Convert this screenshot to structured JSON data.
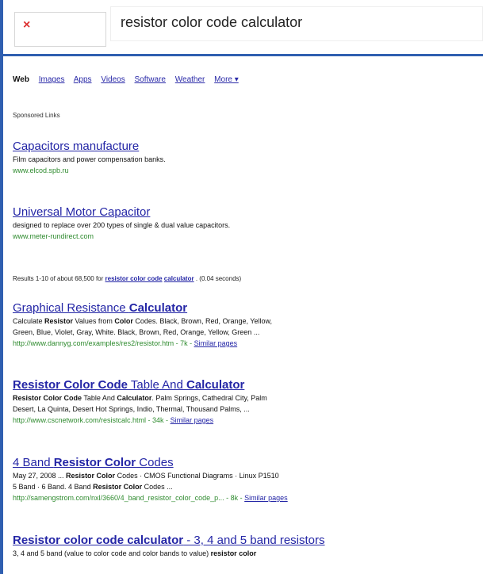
{
  "search": {
    "query": "resistor color code calculator",
    "close_glyph": "×"
  },
  "tabs": [
    {
      "label": "Web",
      "active": true
    },
    {
      "label": "Images"
    },
    {
      "label": "Apps"
    },
    {
      "label": "Videos"
    },
    {
      "label": "Software"
    },
    {
      "label": "Weather"
    },
    {
      "label": "More ▾"
    }
  ],
  "sponsored_label": "Sponsored Links",
  "ads": [
    {
      "title": "Capacitors manufacture",
      "desc": "Film capacitors and power compensation banks.",
      "url": "www.elcod.spb.ru"
    },
    {
      "title": "Universal Motor Capacitor",
      "desc": "designed to replace over 200 types of single & dual value capacitors.",
      "url": "www.meter-rundirect.com"
    }
  ],
  "summary": {
    "prefix": "Results 1-10 of about 68,500 for ",
    "q1": "resistor color code",
    "q2": "calculator",
    "suffix": ". (0.04 seconds)"
  },
  "results": [
    {
      "title_a": "Graphical Resistance ",
      "title_b": "Calculator",
      "desc1_a": "Calculate ",
      "desc1_b": "Resistor",
      "desc1_c": " Values from ",
      "desc1_d": "Color",
      "desc1_e": " Codes. Black, Brown, Red, Orange, Yellow,",
      "desc2": "Green, Blue, Violet, Gray, White. Black, Brown, Red, Orange, Yellow, Green ...",
      "url": "http://www.dannyg.com/examples/res2/resistor.htm - 7k - ",
      "similar": "Similar pages"
    },
    {
      "title_a": "Resistor Color Code",
      "title_b": " Table And ",
      "title_c": "Calculator",
      "desc1_a": "Resistor Color Code",
      "desc1_b": " Table And ",
      "desc1_c": "Calculator",
      "desc1_d": ". Palm Springs, Cathedral City, Palm",
      "desc2": "Desert, La Quinta, Desert Hot Springs, Indio, Thermal, Thousand Palms, ...",
      "url": "http://www.cscnetwork.com/resistcalc.html - 34k - ",
      "similar": "Similar pages"
    },
    {
      "title_a": "4 Band ",
      "title_b": "Resistor Color",
      "title_c": " Codes",
      "desc1_a": "May 27, 2008 ... ",
      "desc1_b": "Resistor Color",
      "desc1_c": " Codes · CMOS Functional Diagrams · Linux P1510",
      "desc2_a": "5 Band · 6 Band. 4 Band ",
      "desc2_b": "Resistor Color",
      "desc2_c": " Codes ...",
      "url": "http://samengstrom.com/nxl/3660/4_band_resistor_color_code_p... - 8k - ",
      "similar": "Similar pages"
    },
    {
      "title_a": "Resistor color code calculator",
      "title_b": " - 3, 4 and 5 band resistors",
      "desc1_a": "3, 4 and 5 band (value to color code and color bands to value) ",
      "desc1_b": "resistor color"
    }
  ]
}
